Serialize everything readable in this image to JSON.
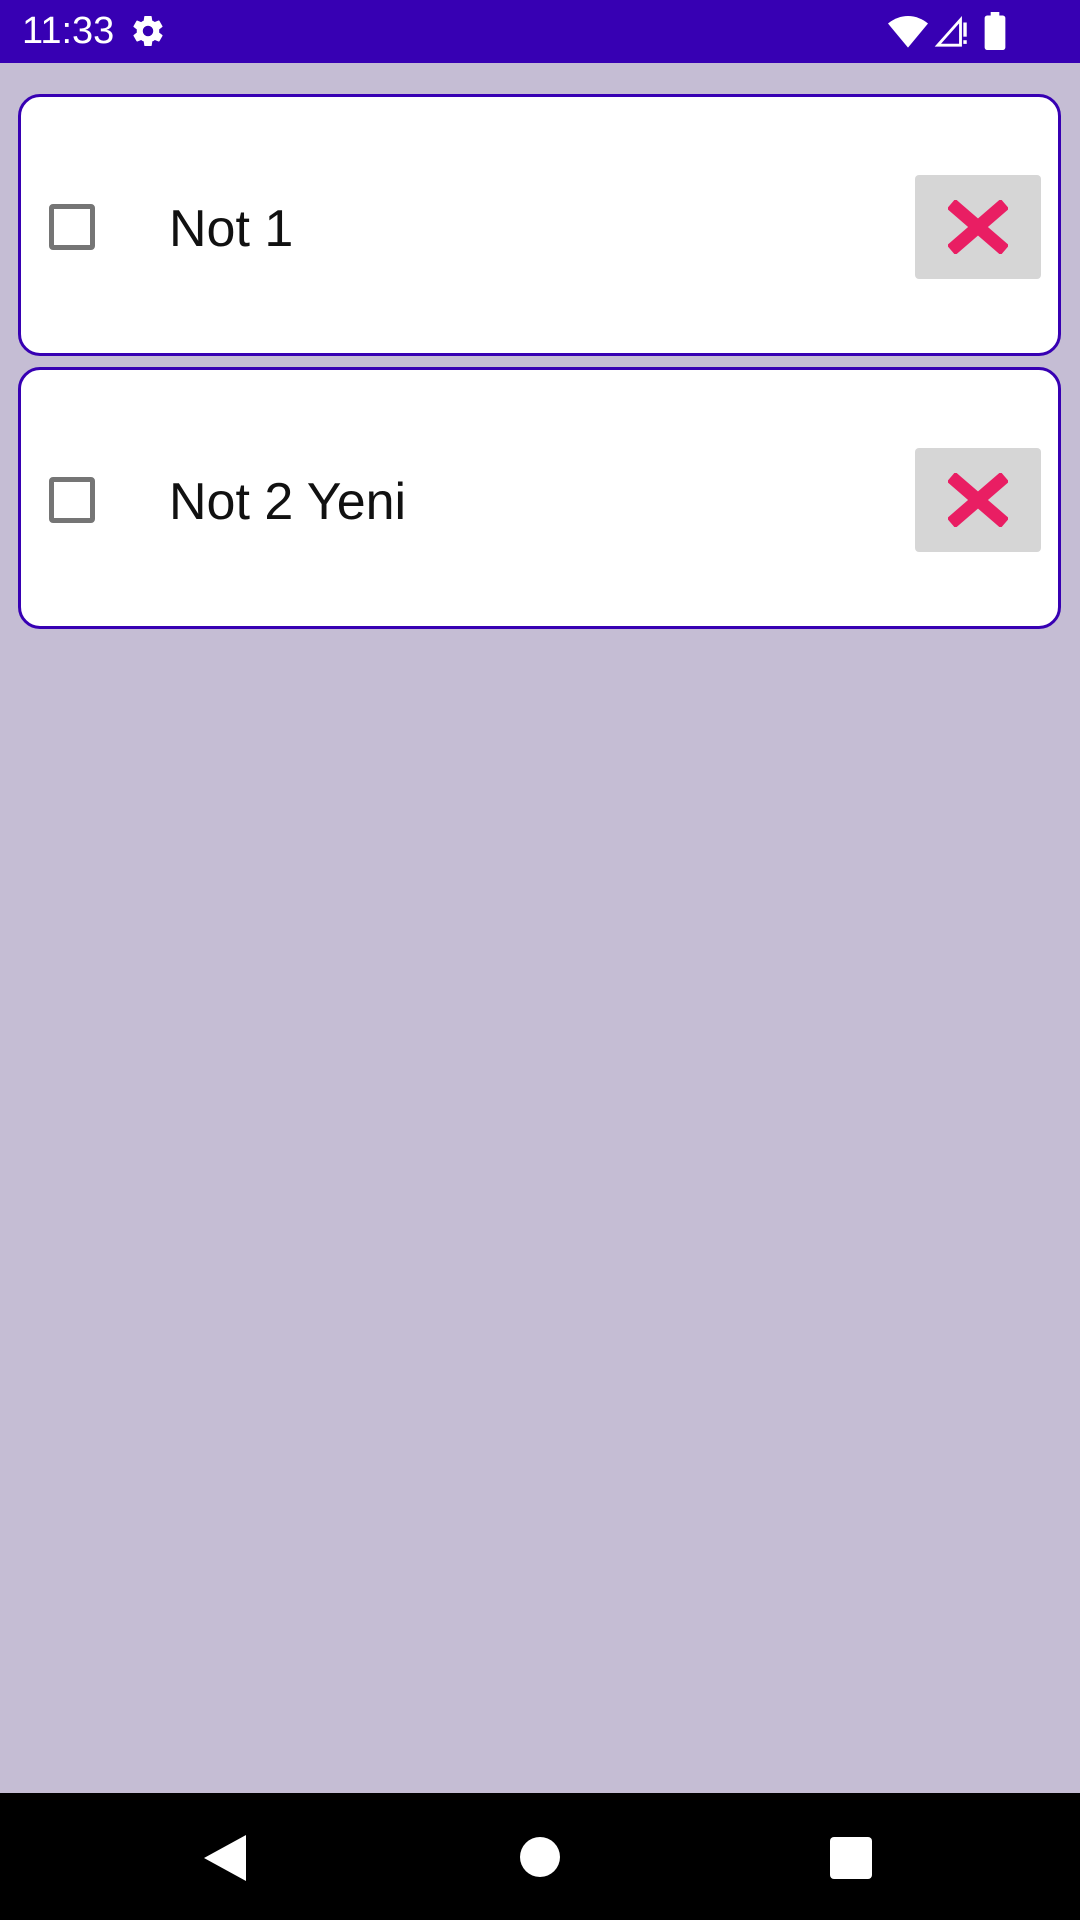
{
  "status_bar": {
    "time": "11:33",
    "color": "#3700b3",
    "icons": [
      "gear-icon",
      "wifi-icon",
      "cell-signal-icon",
      "battery-icon"
    ]
  },
  "notes": [
    {
      "label": "Not 1",
      "checked": false
    },
    {
      "label": "Not 2 Yeni",
      "checked": false
    }
  ],
  "colors": {
    "background": "#c5bdd4",
    "card_border": "#3700b3",
    "delete_icon": "#e91e63",
    "delete_button": "#d6d6d6"
  },
  "nav_bar": {
    "icons": [
      "back-icon",
      "home-icon",
      "recents-icon"
    ]
  }
}
